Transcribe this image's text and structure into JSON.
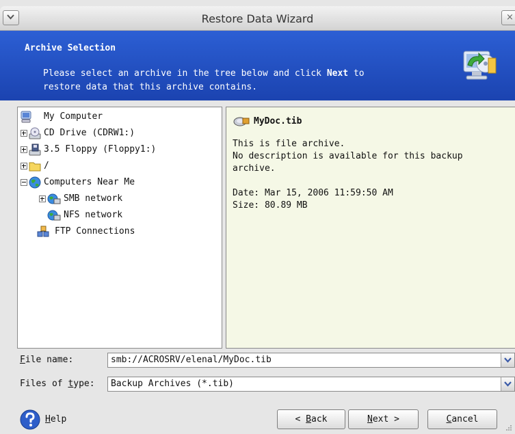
{
  "window": {
    "title": "Restore Data Wizard",
    "close_glyph": "×"
  },
  "banner": {
    "heading": "Archive Selection",
    "desc_line1_pre": "Please select an archive in the tree below and click ",
    "desc_bold": "Next",
    "desc_line1_post": " to",
    "desc_line2": "restore data that this archive contains."
  },
  "tree": {
    "items": [
      {
        "label": "My Computer",
        "icon": "computer-icon"
      },
      {
        "label": "CD Drive (CDRW1:)",
        "icon": "cd-drive-icon",
        "expander": "plus"
      },
      {
        "label": "3.5 Floppy (Floppy1:)",
        "icon": "floppy-icon",
        "expander": "plus"
      },
      {
        "label": "/",
        "icon": "folder-icon",
        "expander": "plus"
      },
      {
        "label": "Computers Near Me",
        "icon": "globe-icon",
        "expander": "minus"
      },
      {
        "label": "SMB network",
        "icon": "network-icon",
        "expander": "plus"
      },
      {
        "label": "NFS network",
        "icon": "network-icon"
      },
      {
        "label": "FTP Connections",
        "icon": "ftp-icon"
      }
    ]
  },
  "info": {
    "filename": "MyDoc.tib",
    "line1": "This is file archive.",
    "line2": "No description is available for this backup",
    "line3": "archive.",
    "date": "Date: Mar 15, 2006 11:59:50 AM",
    "size": "Size: 80.89 MB"
  },
  "fields": {
    "filename_label_ul": "F",
    "filename_label_rest": "ile name:",
    "filename_value": "smb://ACROSRV/elenal/MyDoc.tib",
    "type_label_pre": "Files of ",
    "type_label_ul": "t",
    "type_label_post": "ype:",
    "type_value": "Backup Archives (*.tib)"
  },
  "buttons": {
    "help_ul": "H",
    "help_rest": "elp",
    "back_pre": "< ",
    "back_ul": "B",
    "back_rest": "ack",
    "next_ul": "N",
    "next_rest": "ext >",
    "cancel_ul": "C",
    "cancel_rest": "ancel"
  }
}
